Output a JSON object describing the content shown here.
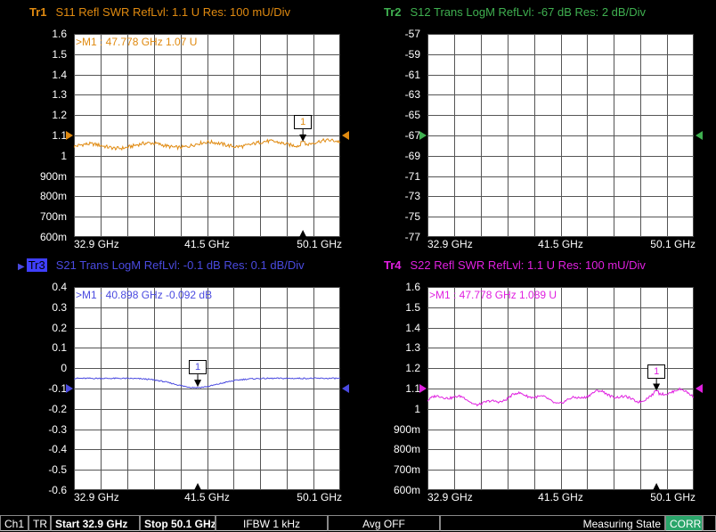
{
  "traces": [
    {
      "id": "tr1",
      "label": "Tr1",
      "boxed": false,
      "color": "#e08a10",
      "title": "S11 Refl SWR RefLvl: 1.1  U Res: 100 mU/Div",
      "yticks": [
        "1.6",
        "1.5",
        "1.4",
        "1.3",
        "1.2",
        "1.1",
        "1",
        "900m",
        "800m",
        "700m",
        "600m"
      ],
      "xticks": [
        "32.9 GHz",
        "41.5 GHz",
        "50.1 GHz"
      ],
      "ymin": 0.6,
      "ymax": 1.6,
      "ref": 1.1,
      "marker": {
        "label": "1",
        "readout": ">M1 :  47.778 GHz  1.07  U",
        "value": 1.07,
        "pos": 0.86
      },
      "curve": "flat"
    },
    {
      "id": "tr2",
      "label": "Tr2",
      "boxed": false,
      "color": "#3fb050",
      "title": "S12 Trans LogM RefLvl: -67  dB Res: 2  dB/Div",
      "yticks": [
        "-57",
        "-59",
        "-61",
        "-63",
        "-65",
        "-67",
        "-69",
        "-71",
        "-73",
        "-75",
        "-77"
      ],
      "xticks": [
        "32.9 GHz",
        "41.5 GHz",
        "50.1 GHz"
      ],
      "ymin": -77,
      "ymax": -57,
      "ref": -67,
      "marker": null,
      "curve": "none"
    },
    {
      "id": "tr3",
      "label": "Tr3",
      "boxed": true,
      "color": "#4a4ae0",
      "title": "S21 Trans LogM RefLvl: -0.1  dB Res: 0.1  dB/Div",
      "yticks": [
        "0.4",
        "0.3",
        "0.2",
        "0.1",
        "0",
        "-0.1",
        "-0.2",
        "-0.3",
        "-0.4",
        "-0.5",
        "-0.6"
      ],
      "xticks": [
        "32.9 GHz",
        "41.5 GHz",
        "50.1 GHz"
      ],
      "ymin": -0.6,
      "ymax": 0.4,
      "ref": -0.1,
      "marker": {
        "label": "1",
        "readout": ">M1 :  40.898 GHz  -0.092  dB",
        "value": -0.092,
        "pos": 0.465
      },
      "curve": "dip"
    },
    {
      "id": "tr4",
      "label": "Tr4",
      "boxed": false,
      "color": "#e020e0",
      "title": "S22 Refl SWR RefLvl: 1.1  U Res: 100 mU/Div",
      "yticks": [
        "1.6",
        "1.5",
        "1.4",
        "1.3",
        "1.2",
        "1.1",
        "1",
        "900m",
        "800m",
        "700m",
        "600m"
      ],
      "xticks": [
        "32.9 GHz",
        "41.5 GHz",
        "50.1 GHz"
      ],
      "ymin": 0.6,
      "ymax": 1.6,
      "ref": 1.1,
      "marker": {
        "label": "1",
        "readout": ">M1 :  47.778 GHz  1.089  U",
        "value": 1.089,
        "pos": 0.86
      },
      "curve": "wavy"
    }
  ],
  "status": {
    "channel": "Ch1",
    "mode": "TR",
    "start": "Start 32.9 GHz",
    "stop": "Stop 50.1 GHz",
    "ifbw": "IFBW 1 kHz",
    "avg": "Avg OFF",
    "state": "Measuring State",
    "corr": "CORR"
  }
}
